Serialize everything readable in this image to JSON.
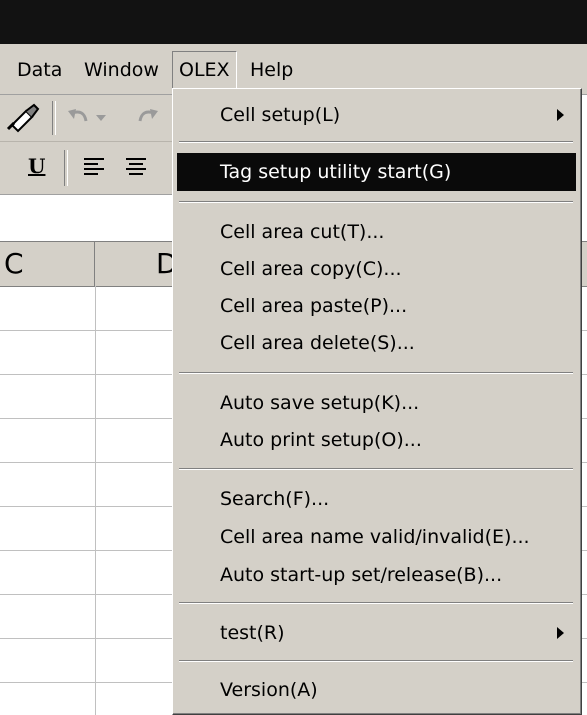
{
  "menubar": {
    "items": [
      {
        "label": "Data"
      },
      {
        "label": "Window"
      },
      {
        "label": "OLEX"
      },
      {
        "label": "Help"
      }
    ]
  },
  "toolbar": {
    "underline_label": "U"
  },
  "sheet": {
    "columns": [
      "C",
      "D"
    ]
  },
  "olex_menu": {
    "items": [
      {
        "label": "Cell setup(L)",
        "submenu": true
      },
      {
        "label": "Tag setup utility start(G)",
        "highlighted": true
      },
      {
        "label": "Cell area cut(T)..."
      },
      {
        "label": "Cell area copy(C)..."
      },
      {
        "label": "Cell area paste(P)..."
      },
      {
        "label": "Cell area delete(S)..."
      },
      {
        "label": "Auto save setup(K)..."
      },
      {
        "label": "Auto print setup(O)..."
      },
      {
        "label": "Search(F)..."
      },
      {
        "label": "Cell area name valid/invalid(E)..."
      },
      {
        "label": "Auto start-up set/release(B)..."
      },
      {
        "label": "test(R)",
        "submenu": true
      },
      {
        "label": "Version(A)"
      }
    ]
  },
  "colors": {
    "menu_face": "#d4d0c8",
    "highlight": "#0a0a0a",
    "titlebar": "#121212"
  }
}
